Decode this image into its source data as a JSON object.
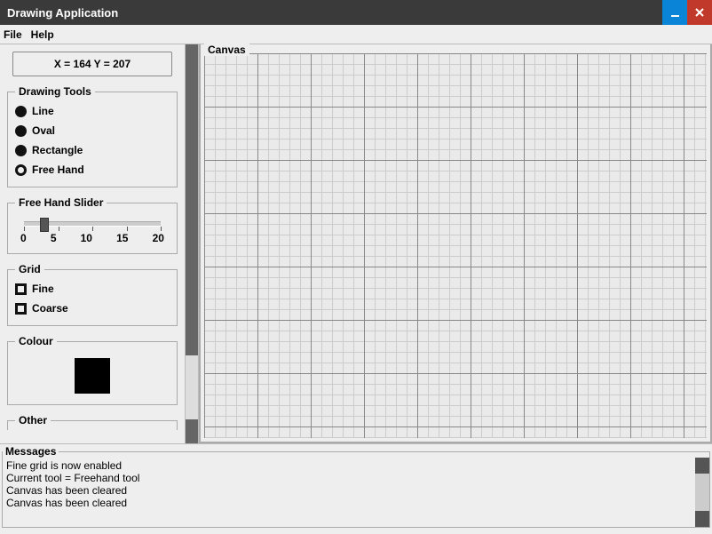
{
  "window": {
    "title": "Drawing Application"
  },
  "menu": {
    "file": "File",
    "help": "Help"
  },
  "coords": {
    "text": "X = 164  Y = 207"
  },
  "toolbox": {
    "title": "Drawing Tools",
    "tools": {
      "line": "Line",
      "oval": "Oval",
      "rectangle": "Rectangle",
      "freehand": "Free Hand"
    },
    "selected": "freehand"
  },
  "slider": {
    "title": "Free Hand Slider",
    "min": 0,
    "max": 20,
    "value": 3,
    "ticks": {
      "t0": "0",
      "t5": "5",
      "t10": "10",
      "t15": "15",
      "t20": "20"
    }
  },
  "grid": {
    "title": "Grid",
    "fine": "Fine",
    "coarse": "Coarse"
  },
  "colour": {
    "title": "Colour",
    "current_hex": "#000000"
  },
  "other": {
    "title": "Other"
  },
  "canvas": {
    "title": "Canvas"
  },
  "messages": {
    "title": "Messages",
    "lines": {
      "l0": "Fine grid is now enabled",
      "l1": "Current tool = Freehand tool",
      "l2": "Canvas has been cleared",
      "l3": "Canvas has been cleared"
    }
  }
}
